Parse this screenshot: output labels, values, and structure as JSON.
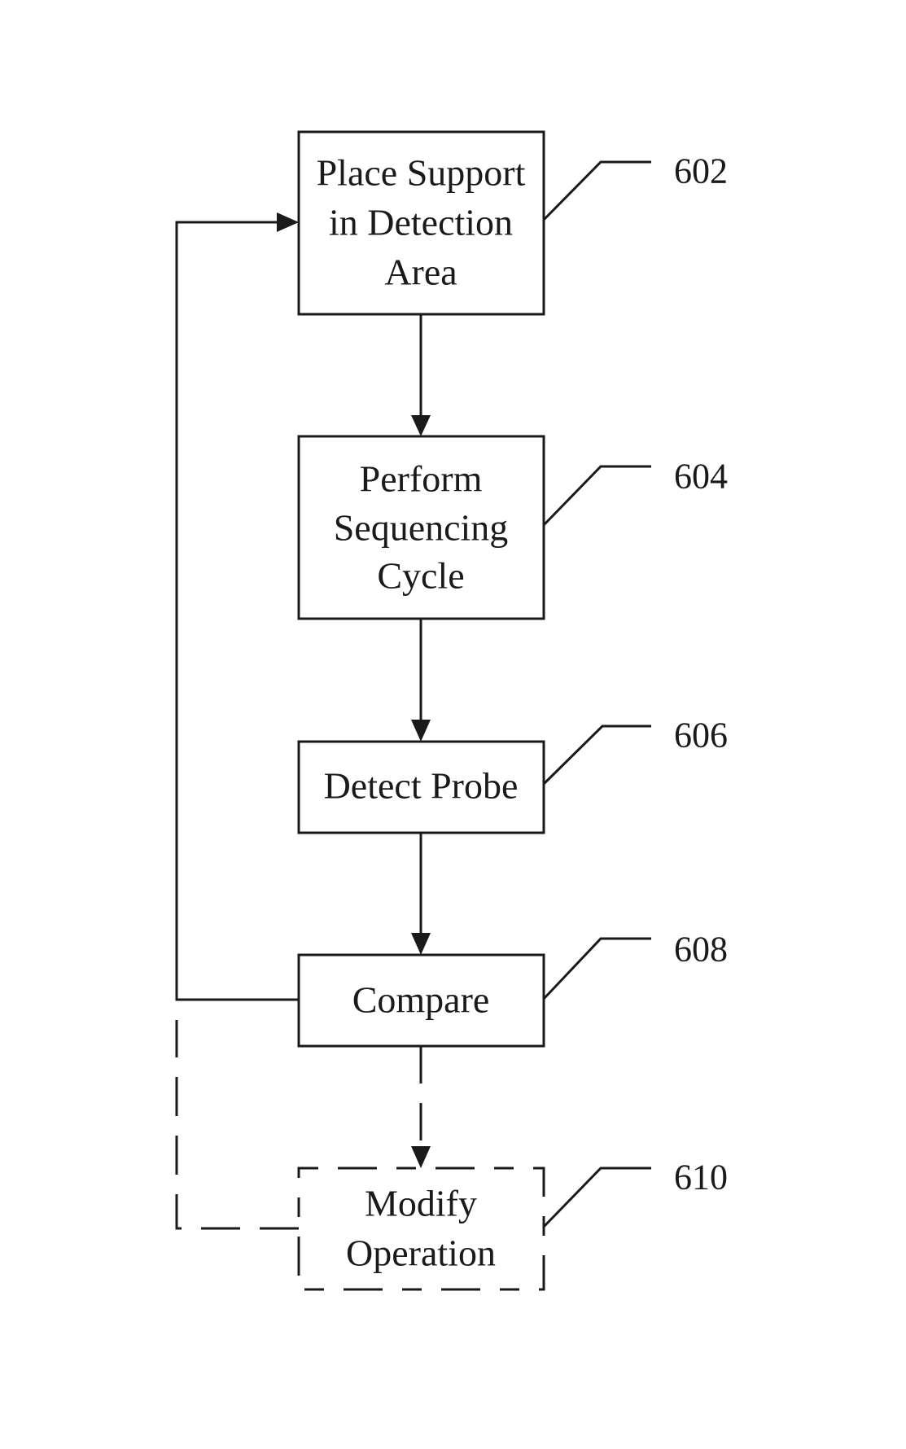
{
  "figure": {
    "type": "flowchart",
    "steps": [
      {
        "id": "602",
        "lines": [
          "Place Support",
          "in Detection",
          "Area"
        ],
        "style": "solid"
      },
      {
        "id": "604",
        "lines": [
          "Perform",
          "Sequencing",
          "Cycle"
        ],
        "style": "solid"
      },
      {
        "id": "606",
        "lines": [
          "Detect Probe"
        ],
        "style": "solid"
      },
      {
        "id": "608",
        "lines": [
          "Compare"
        ],
        "style": "solid"
      },
      {
        "id": "610",
        "lines": [
          "Modify",
          "Operation"
        ],
        "style": "dashed"
      }
    ],
    "connections": [
      {
        "from": "602",
        "to": "604",
        "style": "solid"
      },
      {
        "from": "604",
        "to": "606",
        "style": "solid"
      },
      {
        "from": "606",
        "to": "608",
        "style": "solid"
      },
      {
        "from": "608",
        "to": "602",
        "style": "solid",
        "kind": "feedback-loop"
      },
      {
        "from": "608",
        "to": "610",
        "style": "dashed"
      },
      {
        "from": "610",
        "to": "602",
        "style": "dashed",
        "kind": "feedback-loop"
      }
    ],
    "colors": {
      "ink": "#1a1a1a",
      "background": "#ffffff"
    }
  }
}
